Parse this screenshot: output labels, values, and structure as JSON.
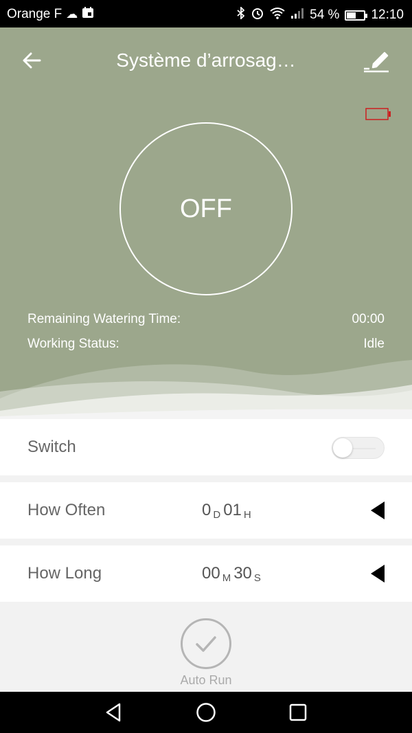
{
  "statusbar": {
    "carrier": "Orange F",
    "battery_percent": "54 %",
    "battery_level": 0.54,
    "time": "12:10"
  },
  "header": {
    "title": "Système d’arrosag…"
  },
  "hero": {
    "power_state": "OFF",
    "remaining_label": "Remaining Watering Time:",
    "remaining_value": "00:00",
    "status_label": "Working Status:",
    "status_value": "Idle",
    "background_color": "#9ca78c",
    "device_battery_color": "#cc1f1f"
  },
  "settings": {
    "switch": {
      "label": "Switch",
      "on": false
    },
    "how_often": {
      "label": "How Often",
      "days": "0",
      "days_unit": "D",
      "hours": "01",
      "hours_unit": "H"
    },
    "how_long": {
      "label": "How Long",
      "minutes": "00",
      "minutes_unit": "M",
      "seconds": "30",
      "seconds_unit": "S"
    }
  },
  "auto_run": {
    "label": "Auto Run"
  },
  "icons": {
    "back": "arrow-left-icon",
    "edit": "pencil-icon",
    "expand": "triangle-left-icon",
    "check": "check-icon"
  }
}
